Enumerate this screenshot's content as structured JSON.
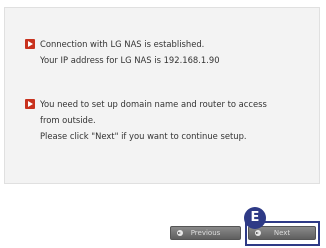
{
  "messages": [
    {
      "lines": [
        "Connection with LG NAS is established.",
        "Your IP address for LG NAS is 192.168.1.90"
      ]
    },
    {
      "lines": [
        "You need to set up domain name and router to access",
        "from outside.",
        "Please click \"Next\" if you want to continue setup."
      ]
    }
  ],
  "buttons": {
    "previous_label": "Previous",
    "next_label": "Next"
  },
  "callout": {
    "label": "E"
  },
  "colors": {
    "bullet": "#c8321e",
    "callout": "#2e3a86",
    "panel_bg": "#f3f3f3"
  }
}
